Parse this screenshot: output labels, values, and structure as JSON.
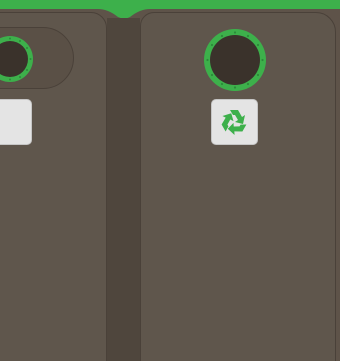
{
  "scene": {
    "background_color": "#5e5349",
    "accent_color": "#3db04b",
    "bins": [
      {
        "label": "",
        "icon": "circular-slot-icon"
      },
      {
        "label": "",
        "icon": "circular-slot-icon"
      }
    ],
    "tiles": [
      {
        "icon": "blank-tile"
      },
      {
        "icon": "recycle-icon",
        "icon_color": "#3db04b"
      }
    ]
  }
}
